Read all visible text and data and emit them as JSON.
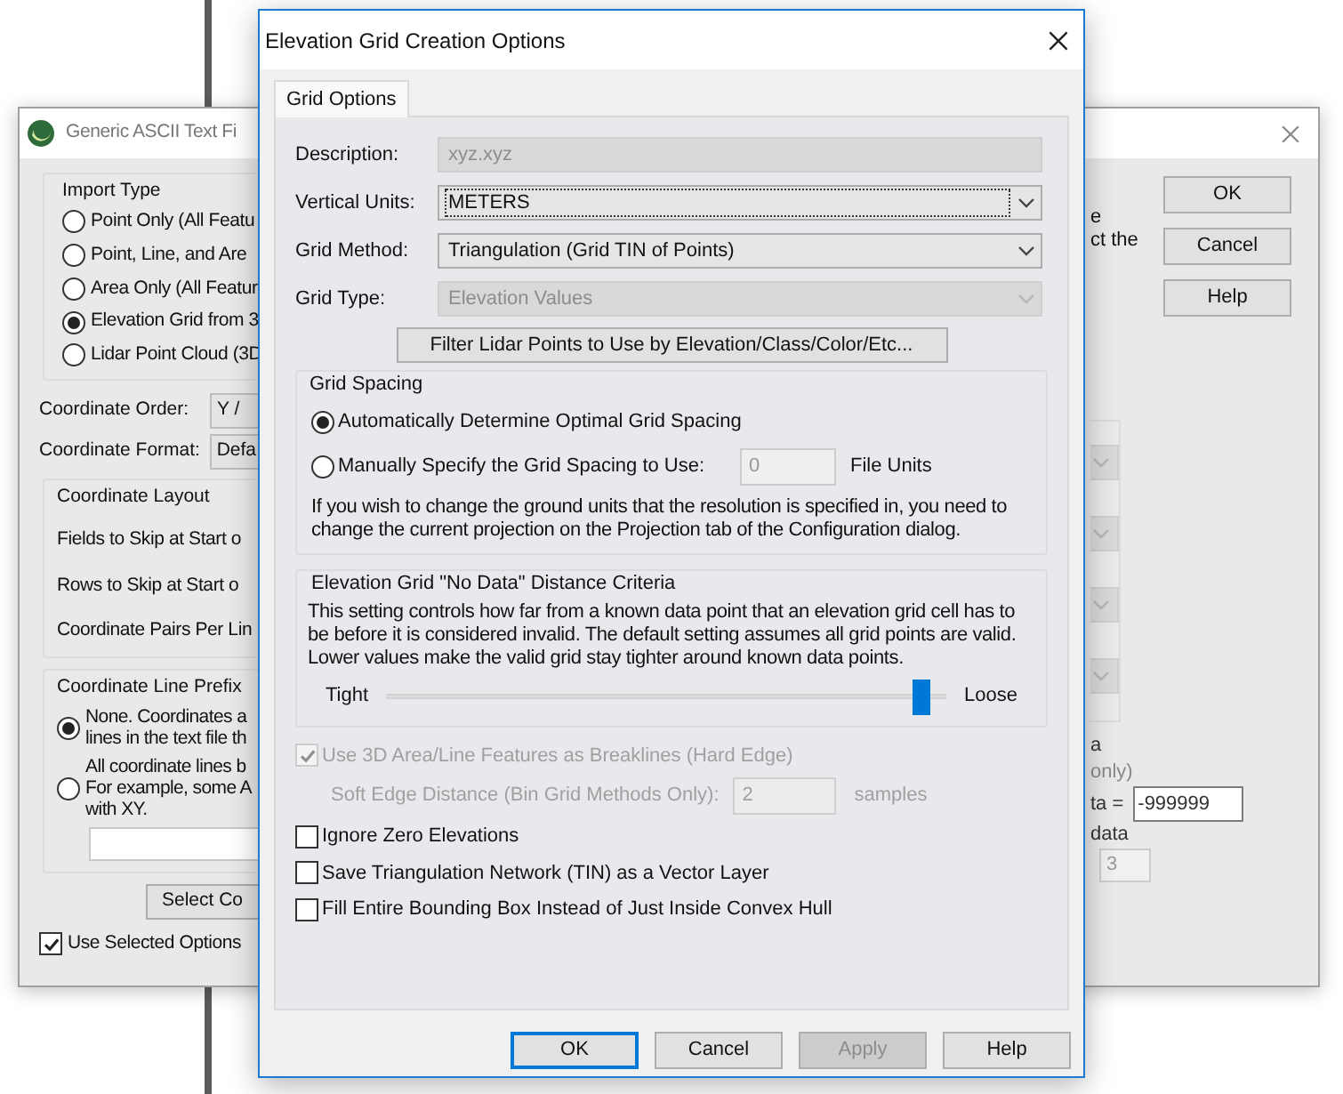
{
  "background_window": {
    "title": "Generic ASCII Text Fi",
    "import_type": {
      "title": "Import Type",
      "options": [
        {
          "label": "Point Only (All Featu",
          "selected": false
        },
        {
          "label": "Point, Line, and Are",
          "selected": false
        },
        {
          "label": "Area Only (All Featur",
          "selected": false
        },
        {
          "label": "Elevation Grid from 3",
          "selected": true
        },
        {
          "label": "Lidar Point Cloud (3D",
          "selected": false
        }
      ]
    },
    "coordinate_order": {
      "label": "Coordinate Order:",
      "value": "Y /"
    },
    "coordinate_format": {
      "label": "Coordinate Format:",
      "value": "Defa"
    },
    "coordinate_layout": {
      "title": "Coordinate Layout",
      "rows": [
        "Fields to Skip at Start o",
        "Rows to Skip at Start o",
        "Coordinate Pairs Per Lin"
      ]
    },
    "line_prefix": {
      "title": "Coordinate Line Prefix",
      "options": [
        {
          "lines": [
            "None. Coordinates a",
            "lines in the text file th"
          ],
          "selected": true
        },
        {
          "lines": [
            "All coordinate lines b",
            "For example, some A",
            "with XY."
          ],
          "selected": false
        }
      ]
    },
    "select_button": "Select Co",
    "use_selected": {
      "label": "Use Selected Options",
      "checked": true
    },
    "buttons": [
      "OK",
      "Cancel",
      "Help"
    ],
    "note_lines": [
      "e",
      "ct the"
    ],
    "combos": [
      {
        "disabled": true
      },
      {
        "disabled": true
      },
      {
        "disabled": true
      },
      {
        "disabled": true
      }
    ],
    "no_data_lines": [
      "a",
      "only)"
    ],
    "no_data_value": {
      "label": "ta =",
      "value": "-999999"
    },
    "data_label": "data",
    "count_field": {
      "value": "3",
      "disabled": true
    }
  },
  "dialog": {
    "title": "Elevation Grid Creation Options",
    "tabs": [
      {
        "label": "Grid Options",
        "selected": true
      }
    ],
    "fields": [
      {
        "kind": "text",
        "label": "Description:",
        "value": "xyz.xyz",
        "disabled": true
      },
      {
        "kind": "combo",
        "label": "Vertical Units:",
        "value": "METERS",
        "disabled": false,
        "focused": true
      },
      {
        "kind": "combo",
        "label": "Grid Method:",
        "value": "Triangulation (Grid TIN of Points)",
        "disabled": false,
        "focused": false
      },
      {
        "kind": "combo",
        "label": "Grid Type:",
        "value": "Elevation Values",
        "disabled": true,
        "focused": false
      }
    ],
    "filter_button": "Filter Lidar Points to Use by Elevation/Class/Color/Etc...",
    "grid_spacing": {
      "title": "Grid Spacing",
      "auto": {
        "label": "Automatically Determine Optimal Grid Spacing",
        "selected": true
      },
      "manual": {
        "label": "Manually Specify the Grid Spacing to Use:",
        "selected": false,
        "value": "0",
        "units": "File Units"
      },
      "note": "If you wish to change the ground units that the resolution is specified in, you need to change the current projection on the Projection tab of the Configuration dialog."
    },
    "no_data": {
      "title": "Elevation Grid \"No Data\" Distance Criteria",
      "description": "This setting controls how far from a known data point that an elevation grid cell has to be before it is considered invalid. The default setting assumes all grid points are valid. Lower values make the valid grid stay tighter around known data points.",
      "slider": {
        "min_label": "Tight",
        "max_label": "Loose",
        "level": 0.97
      }
    },
    "breaklines": {
      "label": "Use 3D Area/Line Features as Breaklines (Hard Edge)",
      "checked": true,
      "disabled": true
    },
    "soft_edge": {
      "label": "Soft Edge Distance (Bin Grid Methods Only):",
      "value": "2",
      "units": "samples",
      "disabled": true
    },
    "options": [
      {
        "label": "Ignore Zero Elevations",
        "checked": false
      },
      {
        "label": "Save Triangulation Network (TIN) as a Vector Layer",
        "checked": false
      },
      {
        "label": "Fill Entire Bounding Box Instead of Just Inside Convex Hull",
        "checked": false
      }
    ],
    "buttons": [
      {
        "label": "OK",
        "kind": "default",
        "disabled": false
      },
      {
        "label": "Cancel",
        "kind": "normal",
        "disabled": false
      },
      {
        "label": "Apply",
        "kind": "normal",
        "disabled": true
      },
      {
        "label": "Help",
        "kind": "normal",
        "disabled": false
      }
    ]
  }
}
